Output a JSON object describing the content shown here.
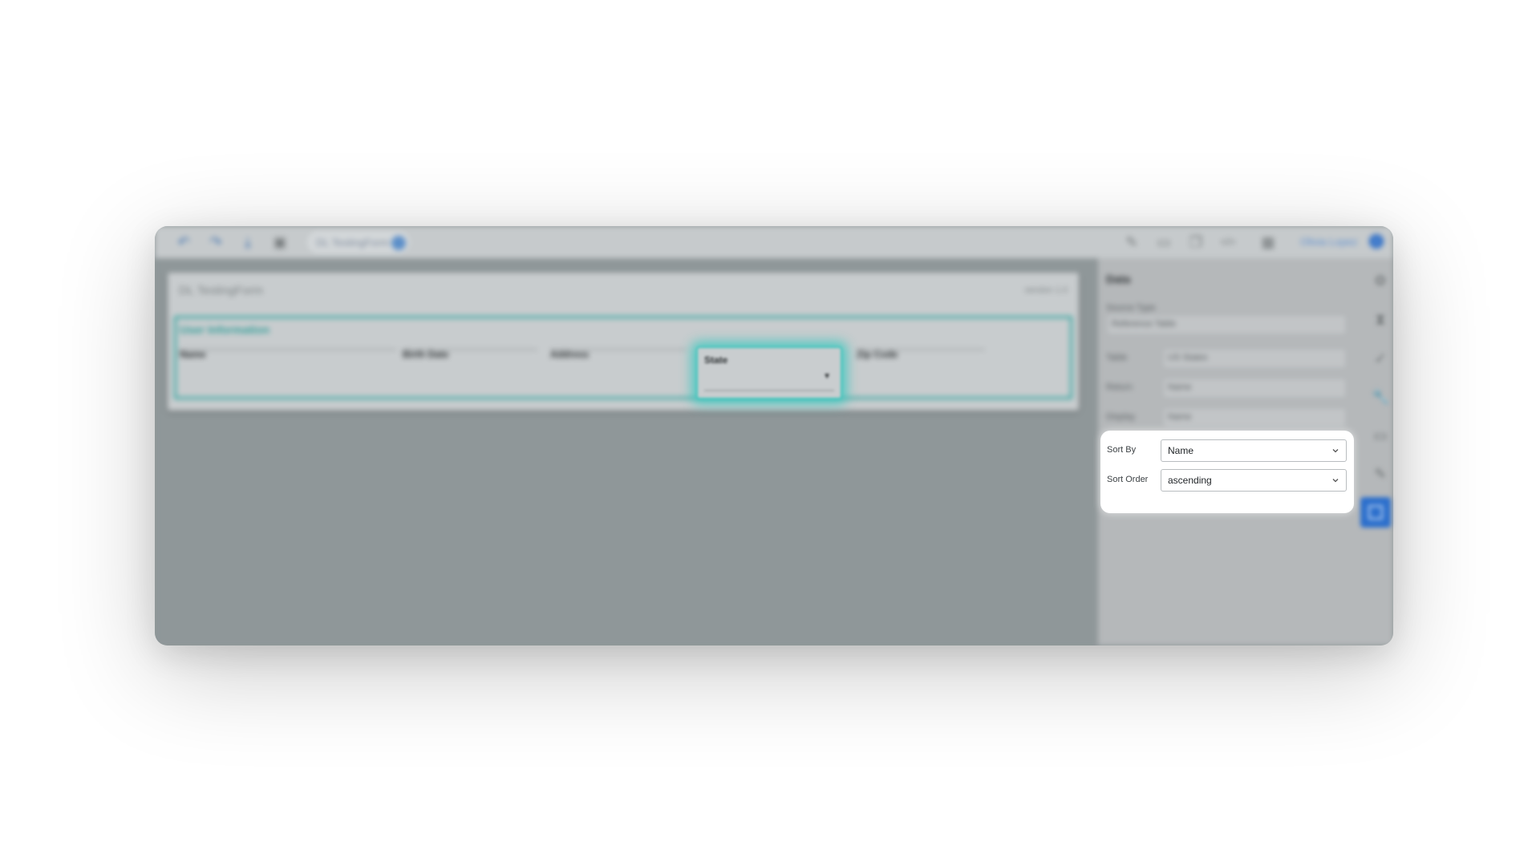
{
  "toolbar": {
    "form_chip_label": "DL TestingForm",
    "user_name": "Olivia Lopez",
    "user_info_glyph": "i",
    "icons": [
      "undo-icon",
      "redo-icon",
      "download-icon",
      "save-icon",
      "pencil-icon",
      "preview-icon",
      "copy-icon",
      "code-icon",
      "grid-icon"
    ]
  },
  "form": {
    "title": "DL TestingForm",
    "version": "version 1.0",
    "section_title": "User Information",
    "fields": [
      "Name",
      "Birth Date",
      "Address",
      "State",
      "Zip Code"
    ]
  },
  "panel": {
    "title": "Data",
    "source_type_label": "Source Type",
    "source_type_value": "Reference Table",
    "table_label": "Table",
    "table_value": "US States",
    "return_label": "Return",
    "return_value": "Name",
    "display_label": "Display",
    "display_value": "Name",
    "sort_by_label": "Sort By",
    "sort_by_value": "Name",
    "sort_order_label": "Sort Order",
    "sort_order_value": "ascending"
  },
  "colors": {
    "accent": "#2c6fcc",
    "section_border": "#3aa7a2",
    "highlight_glow": "#28c8be"
  }
}
